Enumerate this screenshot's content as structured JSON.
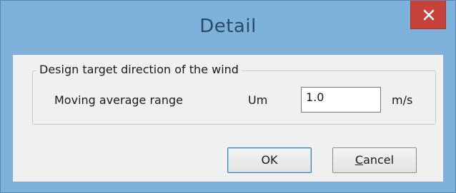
{
  "window": {
    "title": "Detail"
  },
  "group": {
    "title": "Design target direction of the wind"
  },
  "moving_average": {
    "label": "Moving average range",
    "symbol": "Um",
    "value": "1.0",
    "unit": "m/s"
  },
  "buttons": {
    "ok_label": "OK",
    "cancel_label": "Cancel"
  },
  "icons": {
    "close": "close-icon"
  },
  "colors": {
    "titlebar": "#7fb1dd",
    "close_button": "#c7423a",
    "dialog_face": "#f0f0f0"
  }
}
